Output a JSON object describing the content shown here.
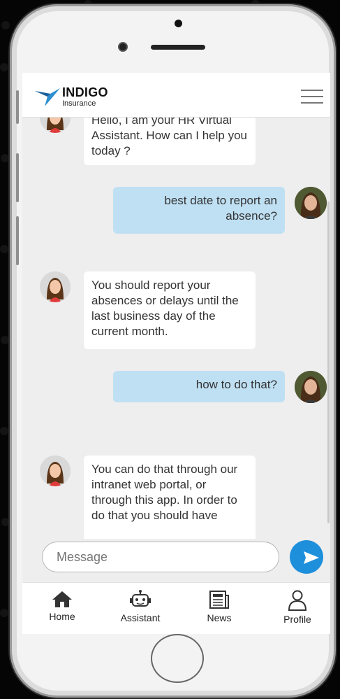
{
  "brand": {
    "name": "INDIGO",
    "subtitle": "Insurance",
    "accent": "#1e8fdb"
  },
  "messages": [
    {
      "from": "bot",
      "text": "Hello, I am your HR Virtual Assistant. How can I help you today ?"
    },
    {
      "from": "user",
      "text": "best date to report an absence?"
    },
    {
      "from": "bot",
      "text": "You should report your absences or delays until the last business day of the current month."
    },
    {
      "from": "user",
      "text": "how to do that?"
    },
    {
      "from": "bot",
      "text": "You can do that through our intranet web portal, or through this app. In order to do that you should have"
    }
  ],
  "composer": {
    "placeholder": "Message"
  },
  "tabs": [
    {
      "label": "Home",
      "icon": "home-icon"
    },
    {
      "label": "Assistant",
      "icon": "robot-icon"
    },
    {
      "label": "News",
      "icon": "newspaper-icon"
    },
    {
      "label": "Profile",
      "icon": "person-icon"
    }
  ],
  "colors": {
    "user_bubble": "#bfe0f3",
    "bot_bubble": "#ffffff",
    "chat_bg": "#eeeeee"
  }
}
